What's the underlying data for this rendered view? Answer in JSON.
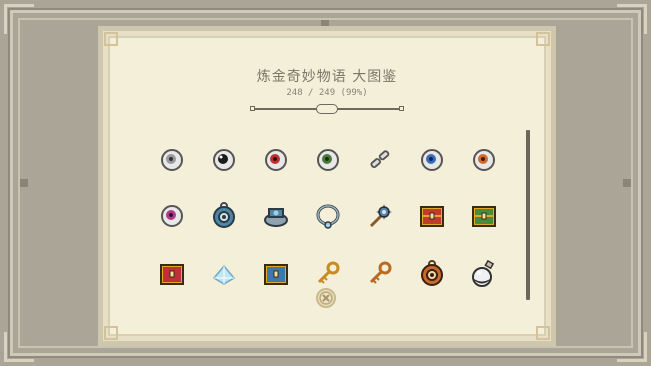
{
  "header": {
    "title": "炼金奇妙物语 大图鉴",
    "collection_count": "248 / 249 (99%)"
  },
  "items": [
    {
      "icon": "eyeball-gray-icon"
    },
    {
      "icon": "eyeball-black-icon"
    },
    {
      "icon": "eyeball-red-icon"
    },
    {
      "icon": "eyeball-green-icon"
    },
    {
      "icon": "broken-chain-icon"
    },
    {
      "icon": "eyeball-blue-icon"
    },
    {
      "icon": "eyeball-orange-icon"
    },
    {
      "icon": "eyeball-magenta-icon"
    },
    {
      "icon": "blue-amulet-icon"
    },
    {
      "icon": "crown-ring-icon"
    },
    {
      "icon": "silver-necklace-icon"
    },
    {
      "icon": "spiked-mace-icon"
    },
    {
      "icon": "golden-chest-red-icon"
    },
    {
      "icon": "golden-chest-green-icon"
    },
    {
      "icon": "red-chest-icon"
    },
    {
      "icon": "ice-crystal-icon"
    },
    {
      "icon": "blue-chest-icon"
    },
    {
      "icon": "golden-key-icon"
    },
    {
      "icon": "bronze-key-icon"
    },
    {
      "icon": "orange-pendant-icon"
    },
    {
      "icon": "potion-bottle-icon"
    }
  ],
  "close": {
    "icon": "close-icon"
  },
  "colors": {
    "frame": "#aaa597",
    "panel": "#f4efd8",
    "text": "#7d7566"
  }
}
